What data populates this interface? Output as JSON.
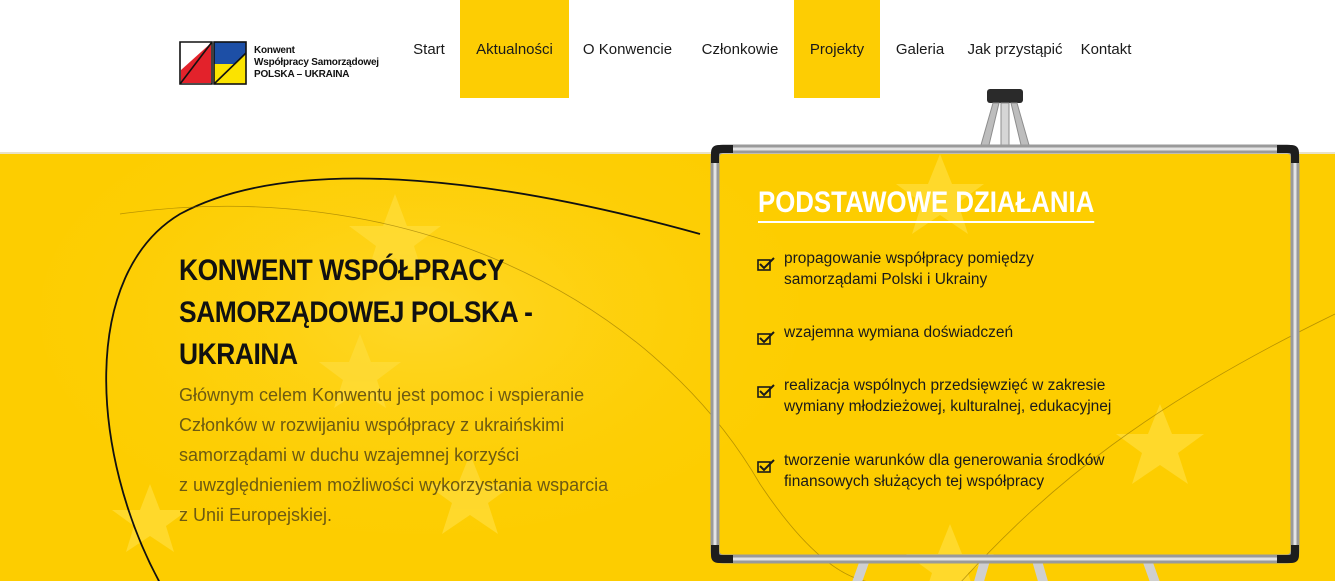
{
  "logo": {
    "lines": [
      "Konwent",
      "Współpracy Samorządowej",
      "POLSKA – UKRAINA"
    ]
  },
  "nav": {
    "items": [
      {
        "label": "Start",
        "active": false
      },
      {
        "label": "Aktualności",
        "active": true
      },
      {
        "label": "O Konwencie",
        "active": false
      },
      {
        "label": "Członkowie",
        "active": false
      },
      {
        "label": "Projekty",
        "active": true
      },
      {
        "label": "Galeria",
        "active": false
      },
      {
        "label": "Jak przystąpić",
        "active": false
      },
      {
        "label": "Kontakt",
        "active": false
      }
    ]
  },
  "hero": {
    "title_lines": [
      "KONWENT WSPÓŁPRACY",
      "SAMORZĄDOWEJ POLSKA - UKRAINA"
    ],
    "text_lines": [
      "Głównym celem Konwentu jest pomoc i wspieranie",
      "Członków w rozwijaniu współpracy z ukraińskimi",
      "samorządami w duchu wzajemnej korzyści",
      "z uwzględnieniem możliwości wykorzystania wsparcia",
      "z Unii Europejskiej."
    ]
  },
  "board": {
    "title": "PODSTAWOWE DZIAŁANIA",
    "items": [
      {
        "lines": [
          "propagowanie współpracy pomiędzy",
          "samorządami Polski i Ukrainy"
        ]
      },
      {
        "lines": [
          "wzajemna wymiana doświadczeń"
        ]
      },
      {
        "lines": [
          "realizacja wspólnych przedsięwzięć w zakresie",
          "wymiany młodzieżowej, kulturalnej, edukacyjnej"
        ]
      },
      {
        "lines": [
          "tworzenie warunków dla generowania środków",
          "finansowych służących tej współpracy"
        ]
      }
    ]
  },
  "colors": {
    "accent_yellow": "#fdcd00",
    "nav_active": "#fdcd03",
    "logo_red": "#e3222b",
    "logo_blue": "#1d4fa6",
    "logo_yellow": "#fbe300"
  }
}
